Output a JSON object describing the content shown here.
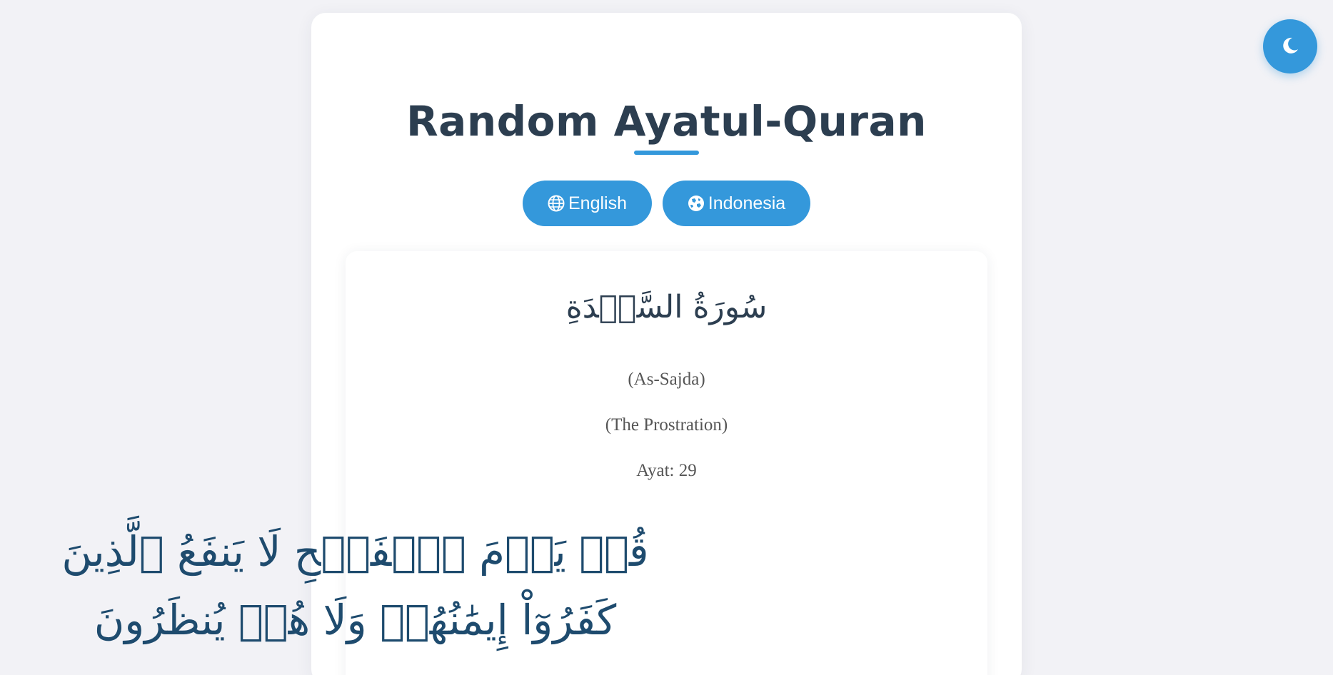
{
  "header": {
    "title": "Random Ayatul-Quran"
  },
  "language_buttons": [
    {
      "label": "English",
      "icon": "globe-icon"
    },
    {
      "label": "Indonesia",
      "icon": "globe-asia-icon"
    }
  ],
  "surah": {
    "name_arabic": "سُورَةُ السَّجۡدَةِ",
    "transliteration": "(As-Sajda)",
    "translation": "(The Prostration)",
    "ayah_label": "Ayat: 29"
  },
  "ayah": {
    "arabic_text": "قُلۡ يَوۡمَ ٱلۡفَتۡحِ لَا يَنفَعُ ٱلَّذِينَ كَفَرُوٓاْ إِيمَٰنُهُمۡ وَلَا هُمۡ يُنظَرُونَ"
  },
  "theme_toggle": {
    "icon": "moon-icon"
  },
  "colors": {
    "accent": "#3498db",
    "title": "#2c3e50",
    "ayah_text": "#1e4b6e",
    "background": "#f2f2f6"
  }
}
